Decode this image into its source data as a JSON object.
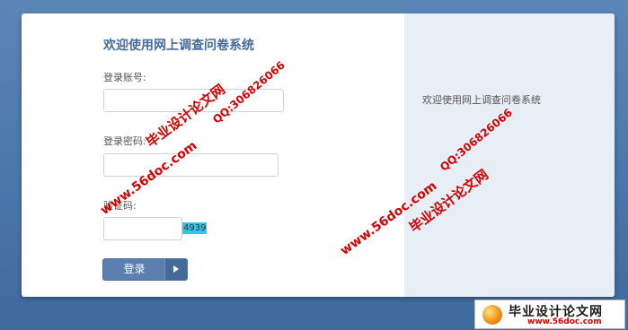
{
  "form": {
    "title": "欢迎使用网上调查问卷系统",
    "account_label": "登录账号:",
    "password_label": "登录密码:",
    "captcha_label": "验证码:",
    "captcha_code": "4939",
    "login_button": "登录",
    "account_value": "",
    "password_value": "",
    "captcha_value": ""
  },
  "side_panel": {
    "text": "欢迎使用网上调查问卷系统"
  },
  "watermarks": {
    "site_name": "毕业设计论文网",
    "url": "www.56doc.com",
    "qq": "QQ:306826066"
  },
  "corner_logo": {
    "name": "毕业设计论文网",
    "url": "www.56doc.com"
  },
  "colors": {
    "background": "#4a77ab",
    "title": "#466b99",
    "button": "#5b7fae",
    "side_panel": "#e8eef6",
    "watermark": "#d40000",
    "captcha_highlight": "#31c6e6"
  }
}
